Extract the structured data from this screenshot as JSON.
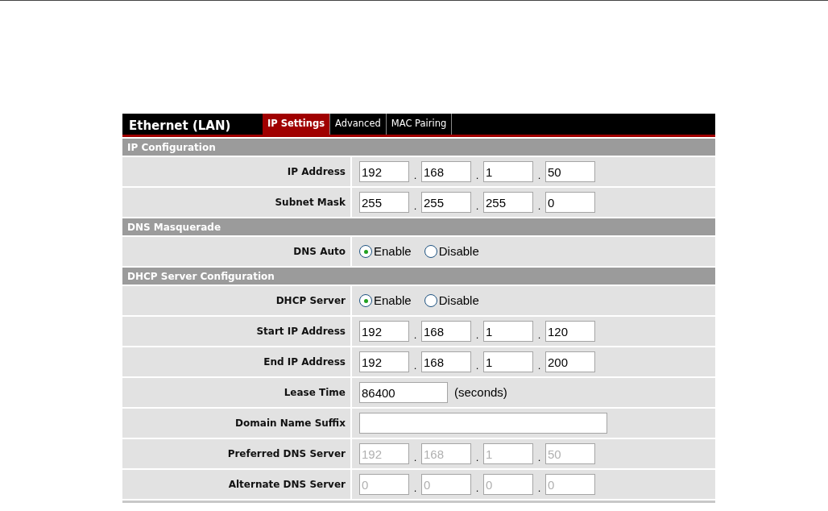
{
  "header": {
    "title": "Ethernet (LAN)"
  },
  "tabs": [
    {
      "label": "IP Settings",
      "selected": true
    },
    {
      "label": "Advanced",
      "selected": false
    },
    {
      "label": "MAC Pairing",
      "selected": false
    }
  ],
  "sections": [
    {
      "title": "IP Configuration",
      "rows": [
        {
          "kind": "ip",
          "label": "IP Address",
          "disabled": false,
          "octets": [
            "192",
            "168",
            "1",
            "50"
          ],
          "separators": [
            ".",
            ".",
            "."
          ]
        },
        {
          "kind": "ip",
          "label": "Subnet Mask",
          "disabled": false,
          "octets": [
            "255",
            "255",
            "255",
            "0"
          ],
          "separators": [
            ".",
            ".",
            "."
          ]
        }
      ]
    },
    {
      "title": "DNS Masquerade",
      "rows": [
        {
          "kind": "radio",
          "label": "DNS Auto",
          "options": [
            {
              "label": "Enable",
              "selected": true
            },
            {
              "label": "Disable",
              "selected": false
            }
          ]
        }
      ]
    },
    {
      "title": "DHCP Server Configuration",
      "rows": [
        {
          "kind": "radio",
          "label": "DHCP Server",
          "options": [
            {
              "label": "Enable",
              "selected": true
            },
            {
              "label": "Disable",
              "selected": false
            }
          ]
        },
        {
          "kind": "ip",
          "label": "Start IP Address",
          "disabled": false,
          "octets": [
            "192",
            "168",
            "1",
            "120"
          ],
          "separators": [
            ".",
            ".",
            "."
          ]
        },
        {
          "kind": "ip",
          "label": "End IP Address",
          "disabled": false,
          "octets": [
            "192",
            "168",
            "1",
            "200"
          ],
          "separators": [
            ".",
            ".",
            "."
          ]
        },
        {
          "kind": "number",
          "label": "Lease Time",
          "value": "86400",
          "unit": "(seconds)"
        },
        {
          "kind": "text",
          "label": "Domain Name Suffix"
        },
        {
          "kind": "ip",
          "label": "Preferred DNS Server",
          "disabled": true,
          "octets": [
            "192",
            "168",
            "1",
            "50"
          ],
          "separators": [
            ".",
            ".",
            "."
          ]
        },
        {
          "kind": "ip",
          "label": "Alternate DNS Server",
          "disabled": true,
          "octets": [
            "0",
            "0",
            "0",
            "0"
          ],
          "separators": [
            ".",
            ".",
            "."
          ]
        }
      ]
    }
  ]
}
